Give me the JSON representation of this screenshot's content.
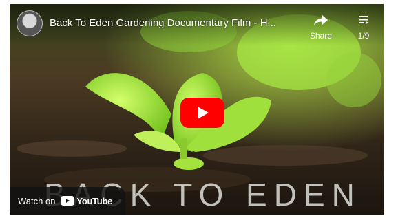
{
  "video": {
    "title": "Back To Eden Gardening Documentary Film - H...",
    "overlay_title": "BACK TO EDEN"
  },
  "controls": {
    "share_label": "Share",
    "playlist_position": "1/9",
    "watch_on_label": "Watch on",
    "youtube_label": "YouTube"
  },
  "colors": {
    "play_button": "#ff0000",
    "soil": "#2a2016",
    "leaf": "#a6e23a"
  },
  "icons": {
    "share": "share-arrow-icon",
    "playlist": "playlist-icon",
    "play": "play-icon",
    "youtube": "youtube-logo-icon"
  }
}
